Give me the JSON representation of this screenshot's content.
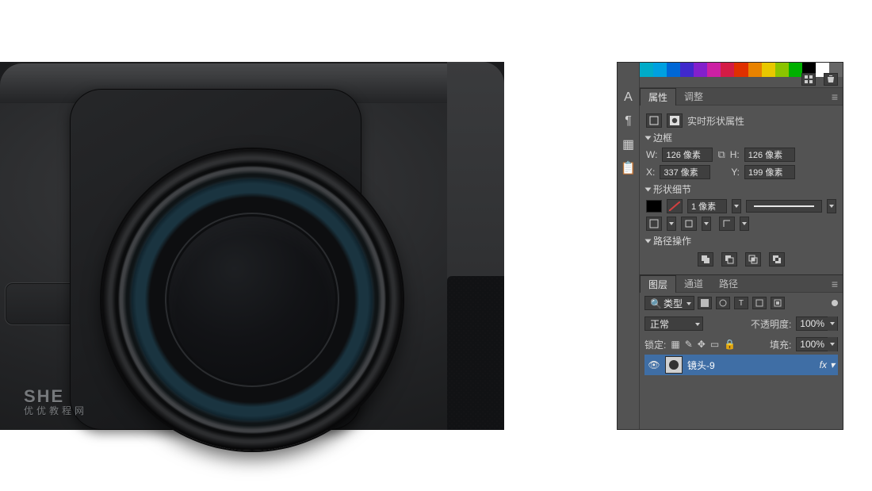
{
  "watermark": {
    "line1": "SHE",
    "line2": "优优教程网"
  },
  "swatches": [
    "#00abc8",
    "#00a0e0",
    "#0067d6",
    "#4029cc",
    "#8320cc",
    "#cc20a3",
    "#d41b45",
    "#e03000",
    "#e88200",
    "#e8c800",
    "#8bc400",
    "#00b000",
    "#000000",
    "#ffffff",
    "#666666"
  ],
  "swatch_tools": {
    "grid_icon": "grid",
    "trash_icon": "trash"
  },
  "leftbar": {
    "char": "A",
    "para": "¶",
    "swatch": "▦",
    "note": "📋"
  },
  "panels": {
    "properties": {
      "tab_properties": "属性",
      "tab_info": "调整",
      "subtitle": "实时形状属性",
      "section_bounding": "边框",
      "w_label": "W:",
      "h_label": "H:",
      "w_value": "126 像素",
      "h_value": "126 像素",
      "x_label": "X:",
      "y_label": "Y:",
      "x_value": "337 像素",
      "y_value": "199 像素",
      "section_shape": "形状细节",
      "stroke_value": "1 像素",
      "section_path": "路径操作"
    },
    "layers": {
      "tab_layers": "图层",
      "tab_channels": "通道",
      "tab_paths": "路径",
      "filter_label": "类型",
      "blend_mode": "正常",
      "opacity_label": "不透明度:",
      "opacity_value": "100%",
      "lock_label": "锁定:",
      "fill_label": "填充:",
      "fill_value": "100%",
      "layer_name": "镜头-9",
      "fx_label": "fx"
    }
  }
}
